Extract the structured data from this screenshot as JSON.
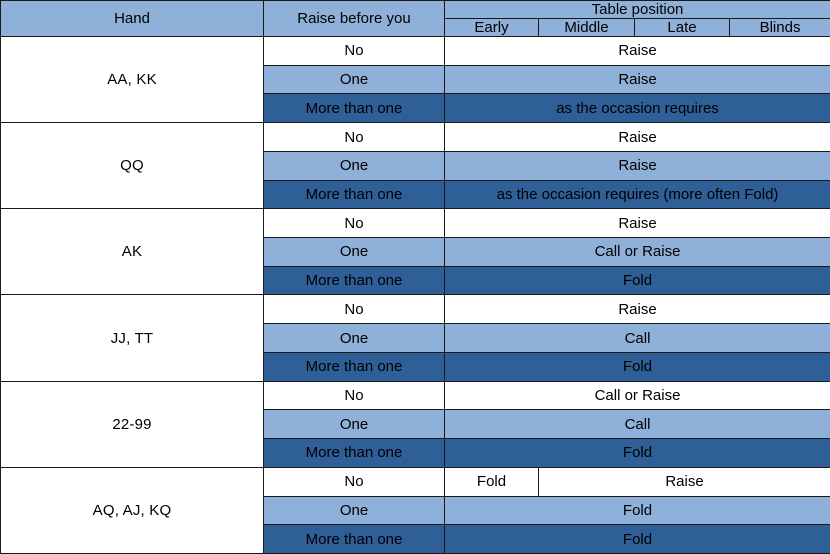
{
  "table": {
    "headers": {
      "hand": "Hand",
      "raise_before_you": "Raise before you",
      "table_position": "Table position",
      "positions": [
        "Early",
        "Middle",
        "Late",
        "Blinds"
      ]
    },
    "raise_options": {
      "none": "No",
      "one": "One",
      "more": "More than one"
    },
    "colors": {
      "header_blue": "#8fb0d8",
      "light_blue": "#8fb0d8",
      "dark_blue": "#2e5f96",
      "white": "#ffffff",
      "border": "#1a1a1a",
      "text_dark": "#000000",
      "text_light": "#ffffff"
    },
    "blocks": [
      {
        "hand": "AA, KK",
        "rows": [
          {
            "raise": "No",
            "style": "no",
            "cells": [
              {
                "text": "Raise",
                "span": 4
              }
            ]
          },
          {
            "raise": "One",
            "style": "one",
            "cells": [
              {
                "text": "Raise",
                "span": 4
              }
            ]
          },
          {
            "raise": "More than one",
            "style": "many",
            "cells": [
              {
                "text": "as the occasion requires",
                "span": 4
              }
            ]
          }
        ]
      },
      {
        "hand": "QQ",
        "rows": [
          {
            "raise": "No",
            "style": "no",
            "cells": [
              {
                "text": "Raise",
                "span": 4
              }
            ]
          },
          {
            "raise": "One",
            "style": "one",
            "cells": [
              {
                "text": "Raise",
                "span": 4
              }
            ]
          },
          {
            "raise": "More than one",
            "style": "many",
            "cells": [
              {
                "text": "as the occasion requires  (more often Fold)",
                "span": 4
              }
            ]
          }
        ]
      },
      {
        "hand": "AK",
        "rows": [
          {
            "raise": "No",
            "style": "no",
            "cells": [
              {
                "text": "Raise",
                "span": 4
              }
            ]
          },
          {
            "raise": "One",
            "style": "one",
            "cells": [
              {
                "text": "Call or Raise",
                "span": 4
              }
            ]
          },
          {
            "raise": "More than one",
            "style": "many",
            "cells": [
              {
                "text": "Fold",
                "span": 4
              }
            ]
          }
        ]
      },
      {
        "hand": "JJ, TT",
        "rows": [
          {
            "raise": "No",
            "style": "no",
            "cells": [
              {
                "text": "Raise",
                "span": 4
              }
            ]
          },
          {
            "raise": "One",
            "style": "one",
            "cells": [
              {
                "text": "Call",
                "span": 4
              }
            ]
          },
          {
            "raise": "More than one",
            "style": "many",
            "cells": [
              {
                "text": "Fold",
                "span": 4
              }
            ]
          }
        ]
      },
      {
        "hand": "22-99",
        "rows": [
          {
            "raise": "No",
            "style": "no",
            "cells": [
              {
                "text": "Call or Raise",
                "span": 4
              }
            ]
          },
          {
            "raise": "One",
            "style": "one",
            "cells": [
              {
                "text": "Call",
                "span": 4
              }
            ]
          },
          {
            "raise": "More than one",
            "style": "many",
            "cells": [
              {
                "text": "Fold",
                "span": 4
              }
            ]
          }
        ]
      },
      {
        "hand": "AQ, AJ, KQ",
        "rows": [
          {
            "raise": "No",
            "style": "no",
            "cells": [
              {
                "text": "Fold",
                "span": 1
              },
              {
                "text": "Raise",
                "span": 3
              }
            ]
          },
          {
            "raise": "One",
            "style": "one-white",
            "cells": [
              {
                "text": "Fold",
                "span": 4
              }
            ]
          },
          {
            "raise": "More than one",
            "style": "many",
            "cells": [
              {
                "text": "Fold",
                "span": 4
              }
            ]
          }
        ]
      }
    ]
  }
}
